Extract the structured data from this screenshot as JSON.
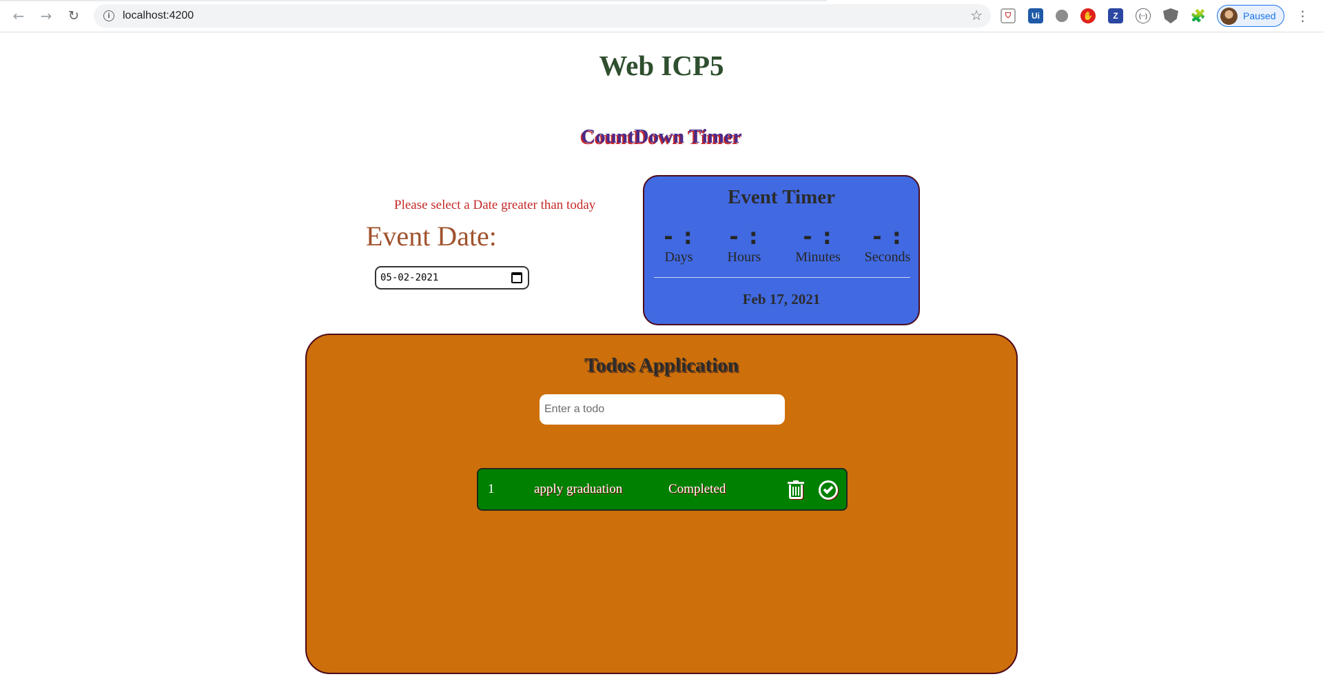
{
  "browser": {
    "url": "localhost:4200",
    "profile_label": "Paused",
    "extensions": [
      {
        "name": "pocket-icon",
        "glyph": "⛉"
      },
      {
        "name": "uipath-icon",
        "glyph": "Ui"
      },
      {
        "name": "extension-circle-icon",
        "glyph": ""
      },
      {
        "name": "adblock-icon",
        "glyph": "✋"
      },
      {
        "name": "zotero-icon",
        "glyph": "Z"
      },
      {
        "name": "extension-ellipsis-icon",
        "glyph": "(··)"
      },
      {
        "name": "shield-extension-icon",
        "glyph": ""
      },
      {
        "name": "puzzle-icon",
        "glyph": "🧩"
      }
    ]
  },
  "page": {
    "title": "Web ICP5"
  },
  "countdown": {
    "heading": "CountDown Timer",
    "warning": "Please select a Date greater than today",
    "event_date_label": "Event Date:",
    "date_value": "05-02-2021"
  },
  "event_timer": {
    "title": "Event Timer",
    "units": [
      {
        "value": "- :",
        "label": "Days"
      },
      {
        "value": "- :",
        "label": "Hours"
      },
      {
        "value": "- :",
        "label": "Minutes"
      },
      {
        "value": "- :",
        "label": "Seconds"
      }
    ],
    "date": "Feb 17, 2021"
  },
  "todos": {
    "title": "Todos Application",
    "input_placeholder": "Enter a todo",
    "items": [
      {
        "index": "1",
        "text": "apply graduation",
        "status": "Completed"
      }
    ]
  },
  "colors": {
    "timer_panel": "#4169e1",
    "todos_panel": "#cd6f0a",
    "todo_item": "#008000",
    "warning": "#c62828"
  }
}
